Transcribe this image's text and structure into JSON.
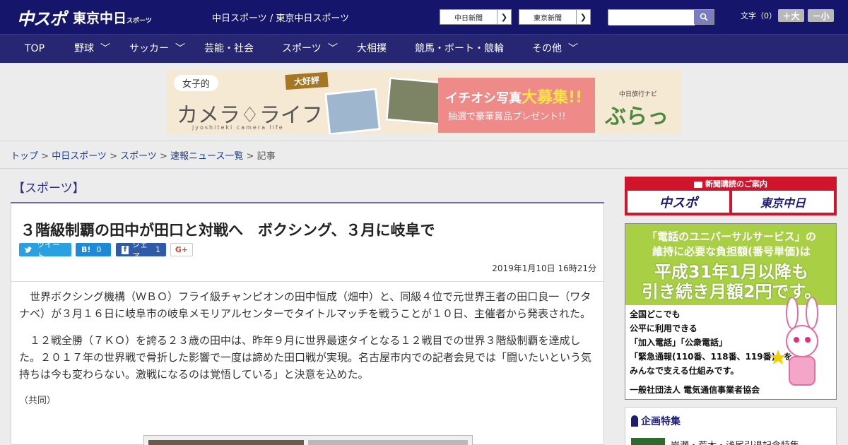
{
  "header": {
    "logo_main": "中スポ",
    "logo_sub": "東京中日",
    "logo_sub_small": "スポーツ",
    "site_links": "中日スポーツ / 東京中日スポーツ",
    "paper_buttons": [
      "中日新聞",
      "東京新聞"
    ],
    "search_placeholder": "",
    "font_size_label": "文字（0）",
    "font_bigger": "＋大",
    "font_smaller": "－小"
  },
  "nav": {
    "items": [
      "TOP",
      "野球",
      "サッカー",
      "芸能・社会",
      "スポーツ",
      "大相撲",
      "競馬・ボート・競輪",
      "その他"
    ]
  },
  "banner": {
    "girl": "女子的",
    "camera": "カメラ♢ライフ",
    "romaji": "jyoshiteki camera life",
    "tag": "大好評",
    "pink_line1": "イチオシ写真",
    "pink_line1_big": "大募集!!",
    "pink_line2": "抽選で豪華賞品プレゼント!!",
    "navi": "中日旅行ナビ",
    "bura": "ぶらっ人"
  },
  "breadcrumb": {
    "items": [
      "トップ",
      "中日スポーツ",
      "スポーツ",
      "速報ニュース一覧"
    ],
    "current": "記事"
  },
  "article": {
    "category": "【スポーツ】",
    "title": "３階級制覇の田中が田口と対戦へ　ボクシング、３月に岐阜で",
    "share": {
      "tweet": "ツイート",
      "hatena": "B!",
      "hatena_count": "0",
      "facebook": "シェア",
      "facebook_count": "1",
      "gplus": "G+"
    },
    "date": "2019年1月10日 16時21分",
    "paragraphs": [
      "世界ボクシング機構（ＷＢＯ）フライ級チャンピオンの田中恒成（畑中）と、同級４位で元世界王者の田口良一（ワタナベ）が３月１６日に岐阜市の岐阜メモリアルセンターでタイトルマッチを戦うことが１０日、主催者から発表された。",
      "１２戦全勝（７ＫＯ）を誇る２３歳の田中は、昨年９月に世界最速タイとなる１２戦目での世界３階級制覇を達成した。２０１７年の世界戦で骨折した影響で一度は諦めた田口戦が実現。名古屋市内での記者会見では「闘いたいという気持ちは今も変わらない。激戦になるのは覚悟している」と決意を込めた。"
    ],
    "credit": "（共同）"
  },
  "sidebar": {
    "subscribe_title": "新聞購読のご案内",
    "subscribe_buttons": [
      "中スポ",
      "東京中日"
    ],
    "ad": {
      "headline1": "「電話のユニバーサルサービス」の",
      "headline2": "維持に必要な負担額(番号単価)は",
      "headline3": "平成31年1月以降も",
      "headline4": "引き続き月額2円です。",
      "lines": [
        "全国どこでも",
        "公平に利用できる",
        "「加入電話」「公衆電話」",
        "「緊急通報(110番、118番、119番)」を",
        "みんなで支える仕組みです。"
      ],
      "footer": "一般社団法人 電気通信事業者協会"
    },
    "feature_title": "企画特集",
    "feature_item": "岩瀬・荒木・浅尾引退記念特集"
  }
}
